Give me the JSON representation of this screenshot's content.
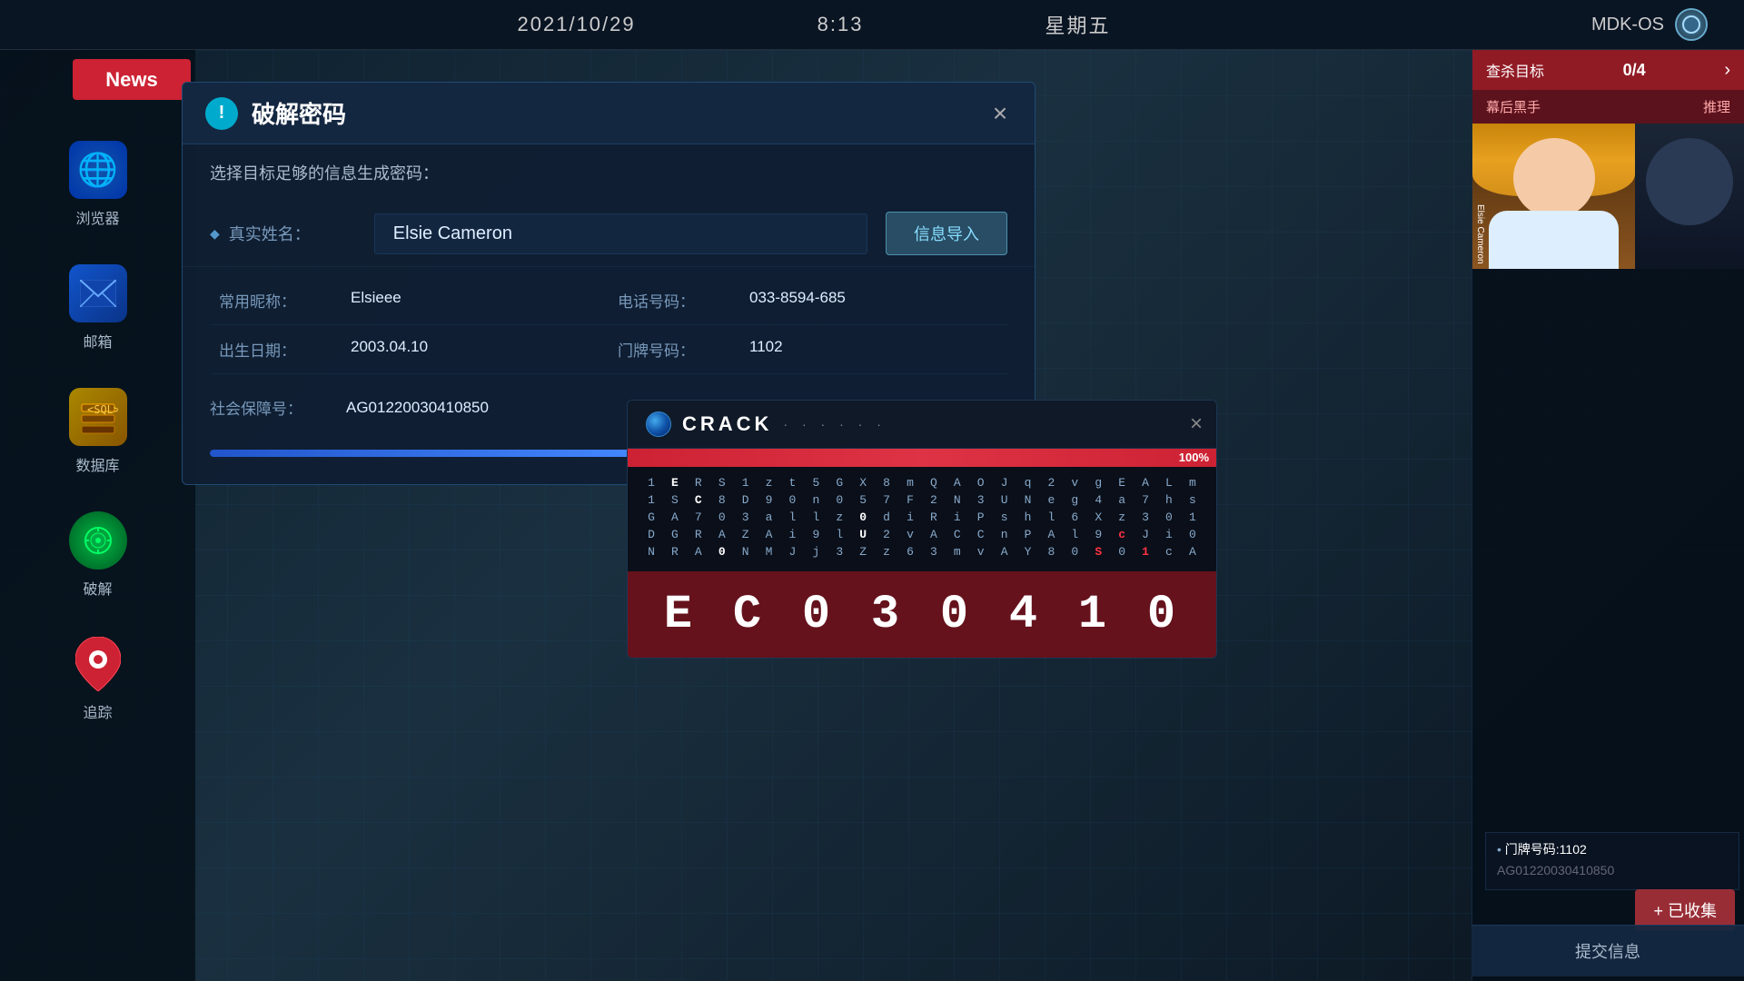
{
  "topbar": {
    "date": "2021/10/29",
    "time": "8:13",
    "day": "星期五",
    "system": "MDK-OS"
  },
  "news_badge": {
    "label": "News"
  },
  "sidebar": {
    "browser_label": "浏览器",
    "mail_label": "邮箱",
    "db_label": "数据库",
    "hack_label": "破解",
    "track_label": "追踪"
  },
  "right_panel": {
    "title": "查杀目标",
    "count": "0/4",
    "sub_title": "幕后黑手",
    "sub_action": "推理",
    "info_label1": "门牌号码:1102",
    "submit": "提交信息"
  },
  "decode_dialog": {
    "title": "破解密码",
    "subtitle": "选择目标足够的信息生成密码：",
    "close": "×",
    "real_name_label": "真实姓名：",
    "real_name_value": "Elsie Cameron",
    "import_btn": "信息导入",
    "nickname_label": "常用昵称：",
    "nickname_value": "Elsieee",
    "phone_label": "电话号码：",
    "phone_value": "033-8594-685",
    "birthday_label": "出生日期：",
    "birthday_value": "2003.04.10",
    "door_label": "门牌号码：",
    "door_value": "1102",
    "ssn_label": "社会保障号：",
    "ssn_value": "AG01220030410850",
    "progress": 55
  },
  "crack_dialog": {
    "title": "CRACK",
    "dots": "· · · · · ·",
    "close": "×",
    "progress": 100,
    "progress_label": "100%",
    "result": "EC03 0 4 1 0",
    "result_chars": [
      "E",
      "C",
      "0",
      "3",
      "0",
      "4",
      "1",
      "0"
    ],
    "matrix": [
      [
        "1",
        "E",
        "R",
        "S",
        "1",
        "z",
        "t",
        "5",
        "G",
        "X",
        "8",
        "m",
        "Q",
        "A",
        "O",
        "J",
        "q",
        "2",
        "v",
        "g",
        "E",
        "A",
        "L",
        "m"
      ],
      [
        "1",
        "S",
        "C",
        "8",
        "D",
        "9",
        "0",
        "n",
        "0",
        "5",
        "7",
        "F",
        "2",
        "N",
        "3",
        "U",
        "N",
        "e",
        "g",
        "4",
        "a",
        "7",
        "h",
        "s"
      ],
      [
        "G",
        "A",
        "7",
        "0",
        "3",
        "a",
        "l",
        "l",
        "z",
        "0",
        "d",
        "i",
        "R",
        "i",
        "P",
        "s",
        "h",
        "l",
        "6",
        "X",
        "z",
        "3",
        "0",
        "1"
      ],
      [
        "D",
        "G",
        "R",
        "A",
        "Z",
        "A",
        "i",
        "9",
        "l",
        "U",
        "2",
        "v",
        "A",
        "C",
        "C",
        "n",
        "P",
        "A",
        "l",
        "9",
        "c",
        "J",
        "i",
        "0"
      ],
      [
        "N",
        "R",
        "A",
        "0",
        "N",
        "M",
        "J",
        "j",
        "3",
        "Z",
        "z",
        "6",
        "3",
        "m",
        "v",
        "A",
        "Y",
        "8",
        "0",
        "S",
        "0",
        "1",
        "c",
        "A"
      ]
    ]
  },
  "collected_badge": {
    "label": "+ 已收集"
  }
}
